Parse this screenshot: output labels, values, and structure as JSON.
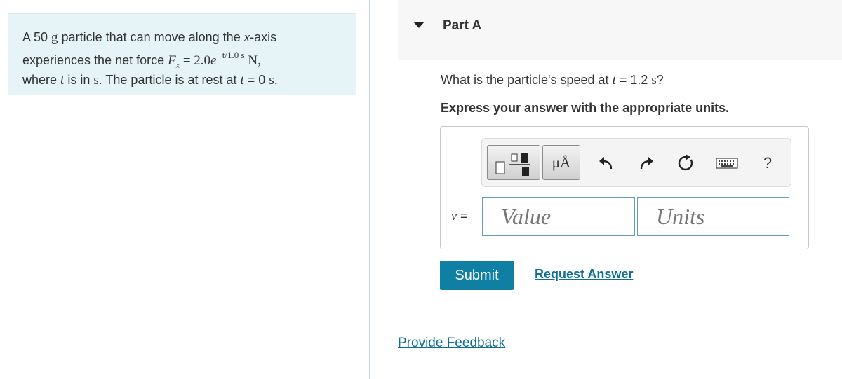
{
  "problem": {
    "line1": {
      "a": "A 50 ",
      "b": "g",
      "c": " particle that can move along the ",
      "d": "x",
      "e": "-axis"
    },
    "line2": {
      "a": "experiences the net force ",
      "b": "F",
      "c": "x",
      "d": " = 2.0",
      "e": "e",
      "f": "−t/1.0 s",
      "g": " N,"
    },
    "line3": {
      "a": "where ",
      "b": "t",
      "c": " is in ",
      "d": "s",
      "e": ". The particle is at rest at ",
      "f": "t",
      "g": " = 0 ",
      "h": "s",
      "i": "."
    }
  },
  "part": {
    "title": "Part A"
  },
  "question": {
    "a": "What is the particle's speed at ",
    "b": "t",
    "c": " = 1.2 ",
    "d": "s",
    "e": "?"
  },
  "instruction": "Express your answer with the appropriate units.",
  "toolbar": {
    "units_button": "μÅ",
    "icons": [
      "templates-icon",
      "undo-icon",
      "redo-icon",
      "reset-icon",
      "keyboard-icon",
      "help-icon"
    ],
    "help": "?"
  },
  "answer": {
    "variable": "v",
    "equals": " =",
    "value_placeholder": "Value",
    "units_placeholder": "Units"
  },
  "actions": {
    "submit": "Submit",
    "request_answer": "Request Answer",
    "provide_feedback": "Provide Feedback"
  },
  "colors": {
    "problem_bg": "#e6f4f7",
    "submit_bg": "#0f7fa3",
    "link": "#0f6f93",
    "field_border": "#5f9fb6"
  }
}
